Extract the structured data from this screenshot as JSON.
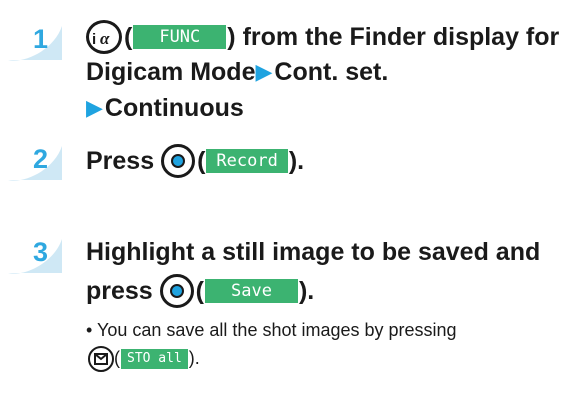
{
  "steps": [
    {
      "number": "1",
      "line1_label": "from the Finder display for",
      "line1_softkey": "FUNC",
      "line2_text": "Digicam Mode",
      "line2_arrow": "▶",
      "line2_after": "Cont. set.",
      "line3_arrow": "▶",
      "line3_text": "Continuous"
    },
    {
      "number": "2",
      "text": "Press",
      "softkey": "Record",
      "after": "."
    },
    {
      "number": "3",
      "line1": "Highlight a still image to be saved and",
      "line2_text": "press",
      "softkey": "Save",
      "after": "."
    }
  ],
  "note": {
    "bullet": "•",
    "text": "You can save all the shot images by pressing",
    "softkey": "STO all",
    "after": "."
  },
  "icons": {
    "step1_key": "i-alpha-key-icon",
    "center_key": "center-select-key-icon",
    "mail_key": "mail-key-icon"
  },
  "colors": {
    "accent": "#1fa3e0",
    "softkey": "#3cb371"
  }
}
